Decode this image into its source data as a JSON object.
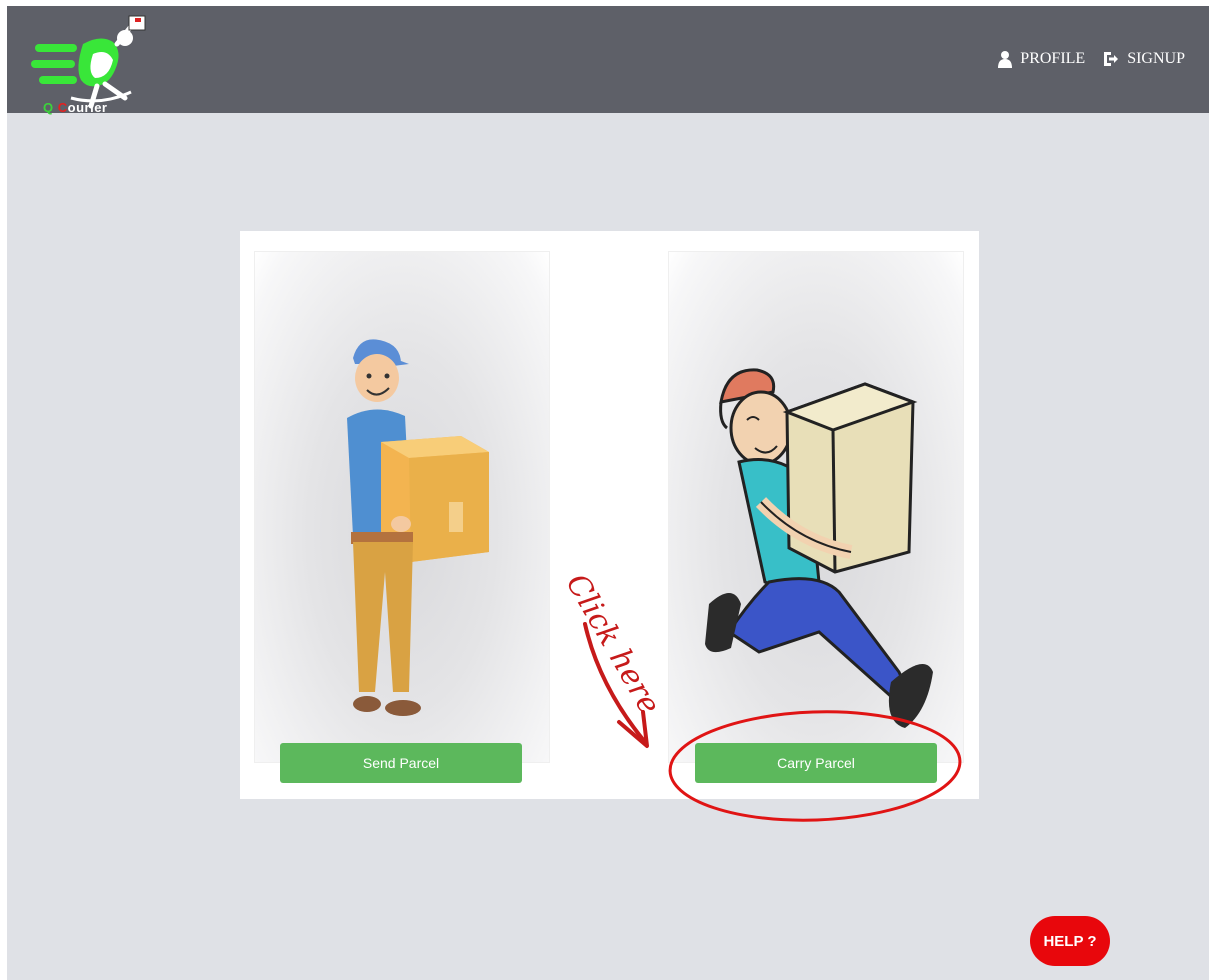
{
  "brand": {
    "logo_icon": "running-courier-logo",
    "q": "Q",
    "c": "C",
    "rest": "ourier"
  },
  "nav": {
    "profile_label": "PROFILE",
    "profile_icon": "user-icon",
    "signup_label": "SIGNUP",
    "signup_icon": "sign-in-icon"
  },
  "options": {
    "send_label": "Send Parcel",
    "carry_label": "Carry Parcel"
  },
  "annotation": {
    "text": "Click here"
  },
  "help": {
    "label": "HELP ?"
  },
  "colors": {
    "header": "#5e6068",
    "background": "#dfe1e6",
    "button_green": "#5cb85c",
    "help_red": "#e8070c",
    "annotation_red": "#c61a1a"
  }
}
